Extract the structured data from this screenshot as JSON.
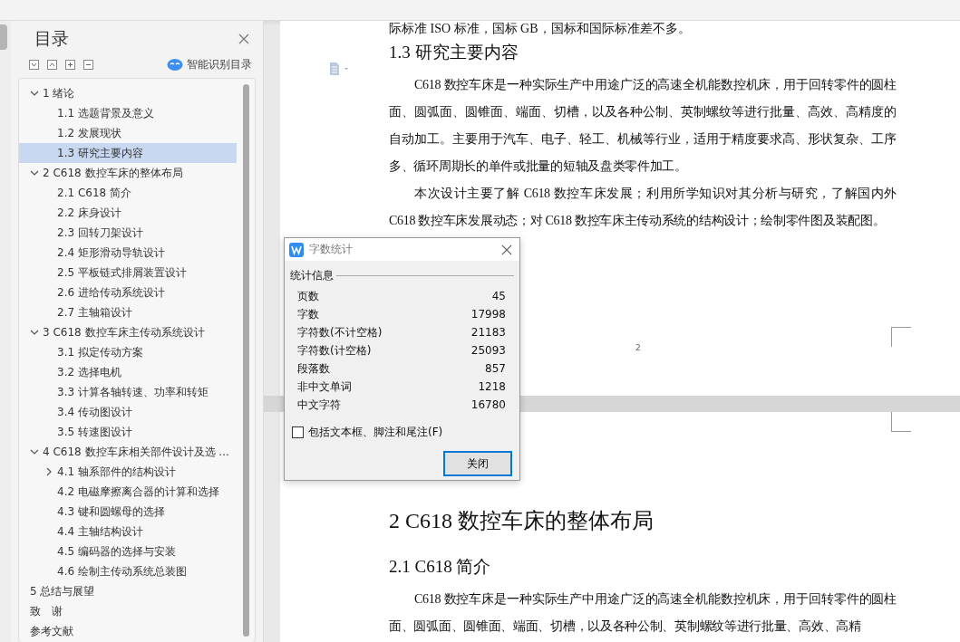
{
  "toc_panel": {
    "title": "目录",
    "smart_button": "智能识别目录",
    "items": [
      {
        "label": "1 绪论",
        "expanded": true,
        "selected": false,
        "children": [
          {
            "label": "1.1 选题背景及意义",
            "selected": false
          },
          {
            "label": "1.2 发展现状",
            "selected": false
          },
          {
            "label": "1.3 研究主要内容",
            "selected": true
          }
        ]
      },
      {
        "label": "2 C618 数控车床的整体布局",
        "expanded": true,
        "selected": false,
        "children": [
          {
            "label": "2.1 C618 简介",
            "selected": false
          },
          {
            "label": "2.2  床身设计",
            "selected": false
          },
          {
            "label": "2.3  回转刀架设计",
            "selected": false
          },
          {
            "label": "2.4  矩形滑动导轨设计",
            "selected": false
          },
          {
            "label": "2.5 平板链式排屑装置设计",
            "selected": false
          },
          {
            "label": "2.6 进给传动系统设计",
            "selected": false
          },
          {
            "label": "2.7 主轴箱设计",
            "selected": false
          }
        ]
      },
      {
        "label": "3 C618 数控车床主传动系统设计",
        "expanded": true,
        "selected": false,
        "children": [
          {
            "label": "3.1  拟定传动方案",
            "selected": false
          },
          {
            "label": "3.2  选择电机",
            "selected": false
          },
          {
            "label": "3.3  计算各轴转速、功率和转矩",
            "selected": false
          },
          {
            "label": "3.4  传动图设计",
            "selected": false
          },
          {
            "label": "3.5  转速图设计",
            "selected": false
          }
        ]
      },
      {
        "label": "4 C618 数控车床相关部件设计及选 ...",
        "expanded": true,
        "selected": false,
        "children": [
          {
            "label": "4.1 轴系部件的结构设计",
            "expanded": false,
            "selected": false
          },
          {
            "label": "4.2 电磁摩擦离合器的计算和选择",
            "selected": false
          },
          {
            "label": "4.3 键和圆螺母的选择",
            "selected": false
          },
          {
            "label": "4.4 主轴结构设计",
            "selected": false
          },
          {
            "label": "4.5 编码器的选择与安装",
            "selected": false
          },
          {
            "label": "4.6 绘制主传动系统总装图",
            "selected": false
          }
        ]
      },
      {
        "label": "5 总结与展望",
        "selected": false
      },
      {
        "label": "致　谢",
        "selected": false
      },
      {
        "label": "参考文献",
        "selected": false
      }
    ]
  },
  "document": {
    "pages": [
      {
        "blocks": [
          {
            "kind": "text",
            "text": "际标准 ISO 标准，国标 GB，国标和国际标准差不多。"
          },
          {
            "kind": "h2",
            "text": "1.3 研究主要内容"
          },
          {
            "kind": "para",
            "text": "C618 数控车床是一种实际生产中用途广泛的高速全机能数控机床，用于回转零件的圆柱面、圆弧面、圆锥面、端面、切槽，以及各种公制、英制螺纹等进行批量、高效、高精度的自动加工。主要用于汽车、电子、轻工、机械等行业，适用于精度要求高、形状复杂、工序多、循环周期长的单件或批量的短轴及盘类零件加工。"
          },
          {
            "kind": "para",
            "text": "本次设计主要了解 C618 数控车床发展；利用所学知识对其分析与研究，了解国内外 C618 数控车床发展动态；对 C618 数控车床主传动系统的结构设计；绘制零件图及装配图。"
          }
        ],
        "page_number": "2"
      },
      {
        "blocks": [
          {
            "kind": "h1",
            "text": "2 C618 数控车床的整体布局"
          },
          {
            "kind": "h2",
            "text": "2.1 C618 简介"
          },
          {
            "kind": "para",
            "text": "C618 数控车床是一种实际生产中用途广泛的高速全机能数控机床，用于回转零件的圆柱面、圆弧面、圆锥面、端面、切槽，以及各种公制、英制螺纹等进行批量、高效、高精"
          }
        ]
      }
    ]
  },
  "dialog": {
    "title": "字数统计",
    "group": "统计信息",
    "stats": [
      {
        "label": "页数",
        "value": "45"
      },
      {
        "label": "字数",
        "value": "17998"
      },
      {
        "label": "字符数(不计空格)",
        "value": "21183"
      },
      {
        "label": "字符数(计空格)",
        "value": "25093"
      },
      {
        "label": "段落数",
        "value": "857"
      },
      {
        "label": "非中文单词",
        "value": "1218"
      },
      {
        "label": "中文字符",
        "value": "16780"
      }
    ],
    "checkbox": {
      "label": "包括文本框、脚注和尾注(F)",
      "checked": false
    },
    "button": "关闭"
  }
}
